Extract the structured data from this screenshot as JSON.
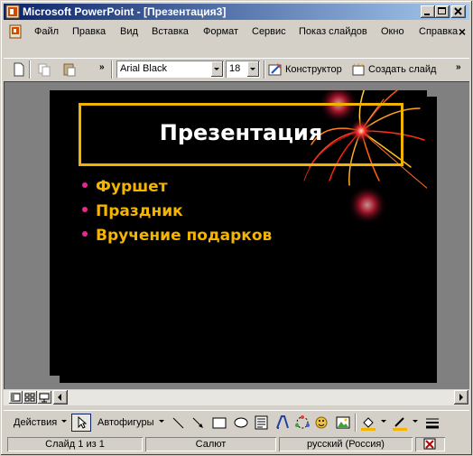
{
  "window": {
    "title": "Microsoft PowerPoint - [Презентация3]"
  },
  "menu": {
    "items": [
      {
        "label": "Файл"
      },
      {
        "label": "Правка"
      },
      {
        "label": "Вид"
      },
      {
        "label": "Вставка"
      },
      {
        "label": "Формат"
      },
      {
        "label": "Сервис"
      },
      {
        "label": "Показ слайдов"
      },
      {
        "label": "Окно"
      },
      {
        "label": "Справка"
      }
    ],
    "close_glyph": "×"
  },
  "toolbar": {
    "font_name": "Arial Black",
    "font_size": "18",
    "designer_label": "Конструктор",
    "new_slide_label": "Создать слайд",
    "overflow_glyph": "»"
  },
  "slide": {
    "title": "Презентация",
    "bullets": [
      "Фуршет",
      "Праздник",
      "Вручение подарков"
    ],
    "colors": {
      "background": "#000000",
      "title_text": "#ffffff",
      "title_border": "#f0b400",
      "bullet_text": "#f4b400",
      "bullet_dot": "#e8288c"
    }
  },
  "drawing_toolbar": {
    "actions_label": "Действия",
    "autoshapes_label": "Автофигуры"
  },
  "status": {
    "slide_counter": "Слайд 1 из 1",
    "design_name": "Салют",
    "language": "русский (Россия)"
  },
  "icons": {
    "app": "powerpoint-icon",
    "doc": "presentation-doc-icon",
    "designer": "designer-icon",
    "new_slide": "new-slide-icon"
  }
}
